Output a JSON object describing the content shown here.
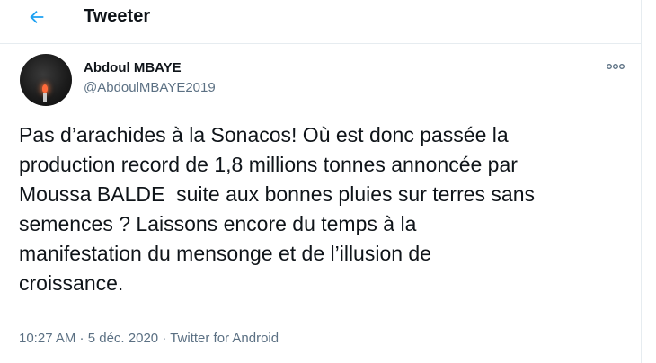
{
  "header": {
    "title": "Tweeter"
  },
  "tweet": {
    "author": {
      "name": "Abdoul MBAYE",
      "handle": "@AbdoulMBAYE2019"
    },
    "text": "Pas d’arachides à la Sonacos! Où est donc passée la\nproduction record de 1,8 millions tonnes annoncée par\nMoussa BALDE  suite aux bonnes pluies sur terres sans\nsemences ? Laissons encore du temps à la\nmanifestation du mensonge et de l’illusion de\ncroissance.",
    "time": "10:27 AM",
    "separator": " · ",
    "date": "5 déc. 2020",
    "source": "Twitter for Android"
  },
  "colors": {
    "accent": "#1da1f2",
    "secondary_text": "#5b7083",
    "border": "#e6ecf0"
  },
  "icons": {
    "back": "back-arrow-icon",
    "more": "more-dots-icon"
  }
}
